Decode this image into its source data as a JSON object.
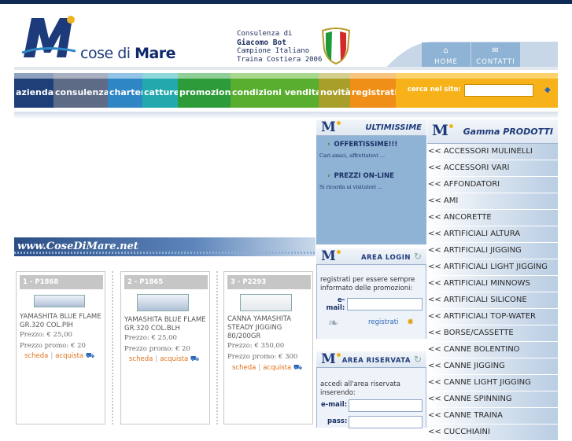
{
  "header": {
    "logo_main": "cose di ",
    "logo_bold": "Mare",
    "consult_line1": "Consulenza di",
    "consult_line2": "Giacomo Bot",
    "consult_line3": "Campione Italiano",
    "consult_line4": "Traina Costiera 2006",
    "tab_home": "HOME",
    "tab_contatti": "CONTATTI"
  },
  "nav": {
    "items": [
      {
        "label": "azienda",
        "color": "#1e3f78",
        "cap": "#8ea0bf"
      },
      {
        "label": "consulenza",
        "color": "#5e6b86",
        "cap": "#a8b0c2"
      },
      {
        "label": "charter",
        "color": "#2f86c4",
        "cap": "#93c3e6"
      },
      {
        "label": "catture",
        "color": "#21a9ae",
        "cap": "#8fd7da"
      },
      {
        "label": "promozioni",
        "color": "#2e9b3a",
        "cap": "#90cf97"
      },
      {
        "label": "condizioni vendita",
        "color": "#5aae2f",
        "cap": "#a9d98f"
      },
      {
        "label": "novità",
        "color": "#a89f2a",
        "cap": "#d4cf8c"
      },
      {
        "label": "registrati",
        "color": "#ef8f18",
        "cap": "#f8c57f"
      }
    ],
    "search_label": "cerca nel sito:",
    "search_value": ""
  },
  "banner": {
    "text": "www.CoseDiMare.net"
  },
  "products": [
    {
      "title": "1 - P1868",
      "name": "YAMASHITA BLUE FLAME GR.320 COL.PIH",
      "price": "Prezzo: € 25,00",
      "promo": "Prezzo promo: € 20",
      "scheda": "scheda",
      "acquista": "acquista"
    },
    {
      "title": "2 - P1865",
      "name": "YAMASHITA BLUE FLAME GR.320 COL.BLH",
      "price": "Prezzo: € 25,00",
      "promo": "Prezzo promo: € 20",
      "scheda": "scheda",
      "acquista": "acquista"
    },
    {
      "title": "3 - P2293",
      "name": "CANNA YAMASHITA STEADY JIGGING 80/200GR",
      "price": "Prezzo: € 350,00",
      "promo": "Prezzo promo: € 300",
      "scheda": "scheda",
      "acquista": "acquista"
    }
  ],
  "ultimissime": {
    "title": "ULTIMISSIME",
    "items": [
      {
        "title": "OFFERTISSIME!!!",
        "desc": "Cari amici, affrettatevi ..."
      },
      {
        "title": "PREZZI ON-LINE",
        "desc": "Si ricorda ai visitatori ..."
      }
    ]
  },
  "login": {
    "title": "AREA LOGIN",
    "text": "registrati per essere sempre informato delle promozioni:",
    "email_label_1": "e-",
    "email_label_2": "mail:",
    "email_value": "",
    "link": "registrati"
  },
  "riservata": {
    "title": "AREA RISERVATA",
    "text": "accedi all'area riservata inserendo:",
    "email_label": "e-mail:",
    "pass_label": "pass:",
    "email_value": "",
    "pass_value": ""
  },
  "gamma": {
    "title": "Gamma PRODOTTI",
    "items": [
      "<< ACCESSORI MULINELLI",
      "<< ACCESSORI VARI",
      "<< AFFONDATORI",
      "<< AMI",
      "<< ANCORETTE",
      "<< ARTIFICIALI ALTURA",
      "<< ARTIFICIALI JIGGING",
      "<< ARTIFICIALI LIGHT JIGGING",
      "<< ARTIFICIALI MINNOWS",
      "<< ARTIFICIALI SILICONE",
      "<< ARTIFICIALI TOP-WATER",
      "<< BORSE/CASSETTE",
      "<< CANNE BOLENTINO",
      "<< CANNE JIGGING",
      "<< CANNE LIGHT JIGGING",
      "<< CANNE SPINNING",
      "<< CANNE TRAINA",
      "<< CUCCHIAINI"
    ]
  }
}
